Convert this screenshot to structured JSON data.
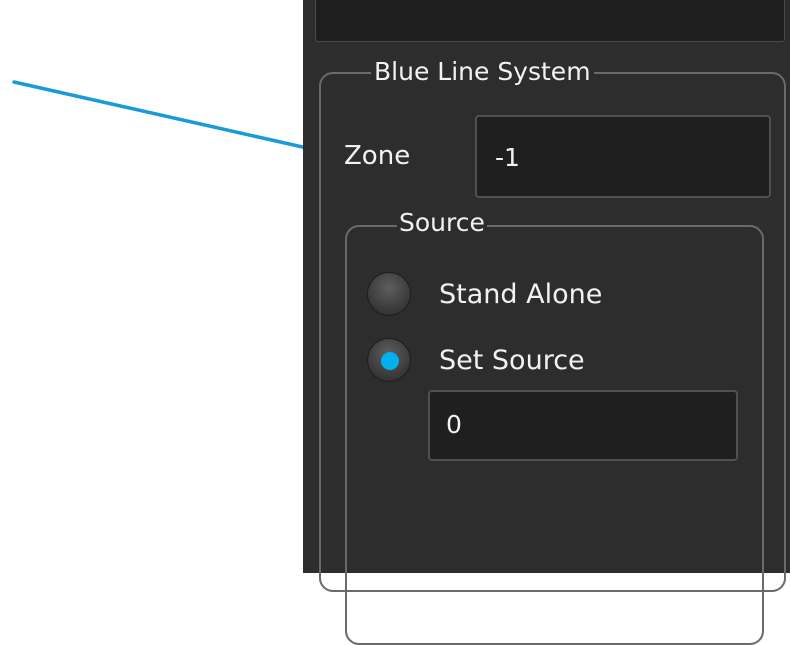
{
  "panel": {
    "group_title": "Blue Line System",
    "zone": {
      "label": "Zone",
      "value": "-1"
    },
    "source": {
      "title": "Source",
      "options": [
        {
          "label": "Stand Alone",
          "selected": false
        },
        {
          "label": "Set Source",
          "selected": true
        }
      ],
      "value": "0"
    }
  },
  "colors": {
    "accent": "#00b0ef",
    "callout": "#1a9ad6",
    "panel_bg": "#2d2d2d"
  }
}
